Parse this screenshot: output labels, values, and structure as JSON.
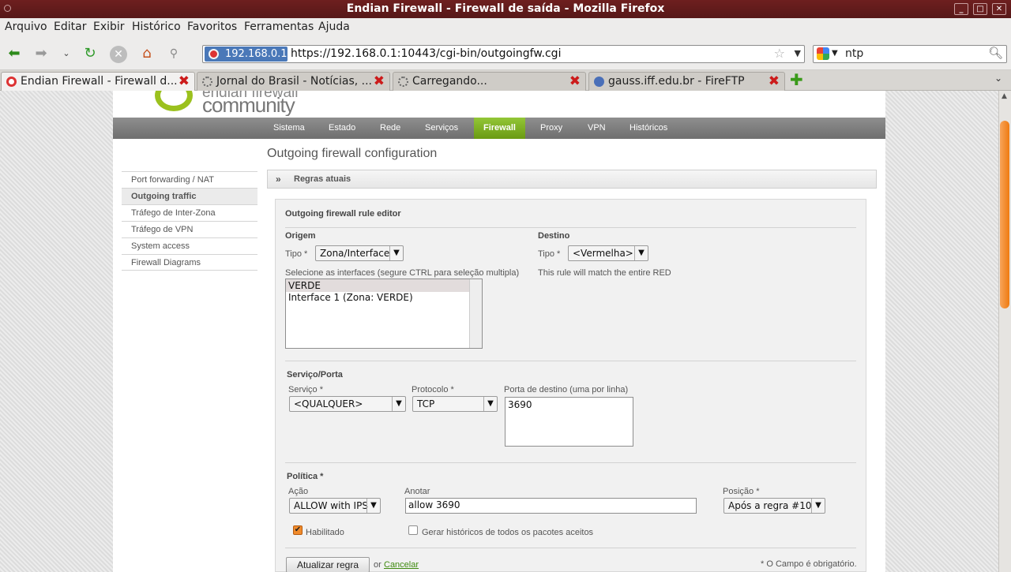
{
  "window": {
    "title": "Endian Firewall - Firewall de saída - Mozilla Firefox"
  },
  "menubar": {
    "items": [
      "Arquivo",
      "Editar",
      "Exibir",
      "Histórico",
      "Favoritos",
      "Ferramentas",
      "Ajuda"
    ]
  },
  "navbar": {
    "identity": "192.168.0.1",
    "url": "https://192.168.0.1:10443/cgi-bin/outgoingfw.cgi",
    "search_value": "ntp"
  },
  "tabs": [
    {
      "label": "Endian Firewall - Firewall d...",
      "active": true
    },
    {
      "label": "Jornal do Brasil - Notícias, ...",
      "active": false
    },
    {
      "label": "Carregando...",
      "active": false
    },
    {
      "label": "gauss.iff.edu.br - FireFTP",
      "active": false
    }
  ],
  "logo": {
    "line1": "endian firewall",
    "line2": "community"
  },
  "topnav": {
    "items": [
      "Sistema",
      "Estado",
      "Rede",
      "Serviços",
      "Firewall",
      "Proxy",
      "VPN",
      "Históricos"
    ],
    "active": "Firewall"
  },
  "page": {
    "title": "Outgoing firewall configuration",
    "sidebar": [
      "Port forwarding / NAT",
      "Outgoing traffic",
      "Tráfego de Inter-Zona",
      "Tráfego de VPN",
      "System access",
      "Firewall Diagrams"
    ],
    "sidebar_active": "Outgoing traffic",
    "section_toggle": "»",
    "section_title": "Regras atuais"
  },
  "editor": {
    "title": "Outgoing firewall rule editor",
    "origem": {
      "heading": "Origem",
      "tipo_label": "Tipo *",
      "tipo_value": "Zona/Interface",
      "list_label": "Selecione as interfaces (segure CTRL para seleção multipla)",
      "list_items": [
        "VERDE",
        "Interface 1 (Zona: VERDE)"
      ]
    },
    "destino": {
      "heading": "Destino",
      "tipo_label": "Tipo *",
      "tipo_value": "<Vermelha>",
      "note": "This rule will match the entire RED"
    },
    "servico": {
      "heading": "Serviço/Porta",
      "service_label": "Serviço *",
      "service_value": "<QUALQUER>",
      "protocol_label": "Protocolo *",
      "protocol_value": "TCP",
      "port_label": "Porta de destino (uma por linha)",
      "port_value": "3690"
    },
    "politica": {
      "heading": "Política *",
      "acao_label": "Ação",
      "acao_value": "ALLOW with IPS",
      "anotar_label": "Anotar",
      "anotar_value": "allow 3690",
      "posicao_label": "Posição *",
      "posicao_value": "Após a regra #10",
      "enabled_label": "Habilitado",
      "enabled": true,
      "log_label": "Gerar históricos de todos os pacotes aceitos",
      "log": false
    },
    "footer": {
      "update_button": "Atualizar regra",
      "or": "or",
      "cancel": "Cancelar",
      "required_note": "* O Campo é obrigatório."
    }
  },
  "colors": {
    "titlebar": "#6e1f1f",
    "accent_green": "#7fb01a",
    "tab_close": "#cc1b1b",
    "scroll_thumb": "#ef7a10"
  }
}
